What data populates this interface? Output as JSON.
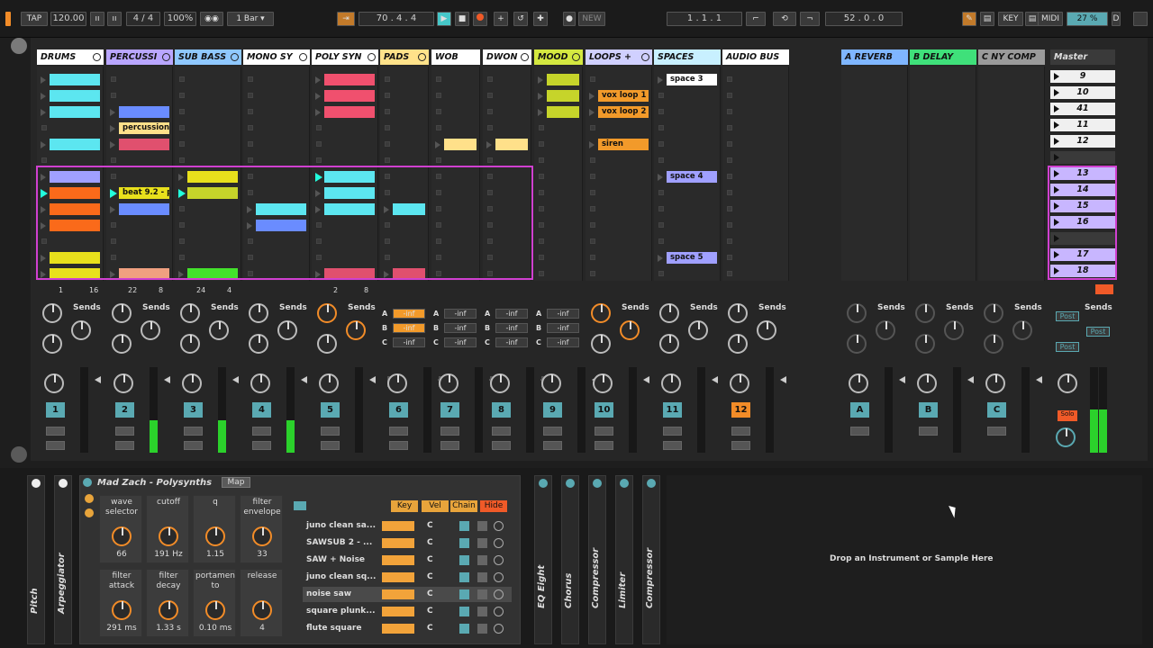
{
  "transport": {
    "tap": "TAP",
    "tempo": "120.00",
    "sig": "4 / 4",
    "zoom": "100%",
    "quant": "1 Bar",
    "pos": "70 .  4 .  4",
    "new": "NEW",
    "loop_start": "1 .  1 .  1",
    "loop_len": "52 .  0 .  0",
    "key": "KEY",
    "midi": "MIDI",
    "cpu": "27 %"
  },
  "tracks": [
    {
      "name": "DRUMS",
      "color": "#ffffff",
      "num": "1",
      "io": [
        "1",
        "16"
      ]
    },
    {
      "name": "PERCUSSI",
      "color": "#b9a6ff",
      "num": "2",
      "io": [
        "22",
        "8"
      ]
    },
    {
      "name": "SUB BASS",
      "color": "#8fc8ff",
      "num": "3",
      "io": [
        "24",
        "4"
      ]
    },
    {
      "name": "MONO SY",
      "color": "#ffffff",
      "num": "4",
      "io": [
        "",
        ""
      ]
    },
    {
      "name": "POLY SYN",
      "color": "#ffffff",
      "num": "5",
      "io": [
        "2",
        "8"
      ]
    },
    {
      "name": "PADS",
      "color": "#ffe28a",
      "num": "6",
      "io": [
        "",
        ""
      ]
    },
    {
      "name": "WOB",
      "color": "#ffffff",
      "num": "7",
      "io": [
        "",
        ""
      ]
    },
    {
      "name": "DWON",
      "color": "#ffffff",
      "num": "8",
      "io": [
        "",
        ""
      ]
    },
    {
      "name": "MOOD",
      "color": "#d4e840",
      "num": "9",
      "io": [
        "",
        ""
      ]
    },
    {
      "name": "LOOPS +",
      "color": "#d0d0ff",
      "num": "10",
      "io": [
        "",
        ""
      ]
    },
    {
      "name": "SPACES",
      "color": "#c8f0ff",
      "num": "11",
      "io": [
        "",
        ""
      ]
    },
    {
      "name": "AUDIO BUS",
      "color": "#ffffff",
      "num": "12",
      "io": [
        "",
        ""
      ]
    }
  ],
  "returns": [
    {
      "name": "A REVERB",
      "color": "#7fb6ff",
      "num": "A"
    },
    {
      "name": "B DELAY",
      "color": "#3fe07a",
      "num": "B"
    },
    {
      "name": "C NY COMP",
      "color": "#9a9a9a",
      "num": "C"
    }
  ],
  "master": {
    "name": "Master",
    "sends": "Sends",
    "post": "Post",
    "solo": "Solo"
  },
  "clips": {
    "percussion": "percussion",
    "beat": "beat 9.2 - pe",
    "vox1": "vox loop 1",
    "vox2": "vox loop 2",
    "siren": "siren",
    "space3": "space 3",
    "space4": "space 4",
    "space5": "space 5"
  },
  "scenes": [
    "9",
    "10",
    "41",
    "11",
    "12",
    "",
    "13",
    "14",
    "15",
    "16",
    "",
    "17",
    "18"
  ],
  "mixer": {
    "sends": "Sends",
    "a": "A",
    "b": "B",
    "c": "C",
    "inf": "-inf"
  },
  "device": {
    "title": "Mad Zach - Polysynths",
    "map": "Map",
    "key": "Key",
    "vel": "Vel",
    "chain": "Chain",
    "hide": "Hide",
    "drop": "Drop an Instrument or Sample Here"
  },
  "macros": [
    {
      "label": "wave selector",
      "value": "66"
    },
    {
      "label": "cutoff",
      "value": "191 Hz"
    },
    {
      "label": "q",
      "value": "1.15"
    },
    {
      "label": "filter envelope",
      "value": "33"
    },
    {
      "label": "filter attack",
      "value": "291 ms"
    },
    {
      "label": "filter decay",
      "value": "1.33 s"
    },
    {
      "label": "portamen to",
      "value": "0.10 ms"
    },
    {
      "label": "release",
      "value": "4"
    }
  ],
  "chains": [
    "juno clean sa...",
    "SAWSUB 2 - ...",
    "SAW + Noise",
    "juno clean sq...",
    "noise saw",
    "square plunk...",
    "flute square"
  ],
  "chain_key": "C",
  "fx": [
    "Pitch",
    "Arpeggiator",
    "EQ Eight",
    "Chorus",
    "Compressor",
    "Limiter",
    "Compressor"
  ],
  "colors": {
    "cyan": "#5ce6f0",
    "red": "#f0506e",
    "orange": "#fa6a1a",
    "yellow": "#f7e01c",
    "blue": "#6a8cff",
    "lav": "#a0a0ff",
    "olive": "#c6d42a",
    "tan": "#ffe08a",
    "amber": "#f29a2a",
    "pink": "#e0506e",
    "green": "#43e22c",
    "peach": "#f0a080",
    "sel": "#d040d0"
  }
}
